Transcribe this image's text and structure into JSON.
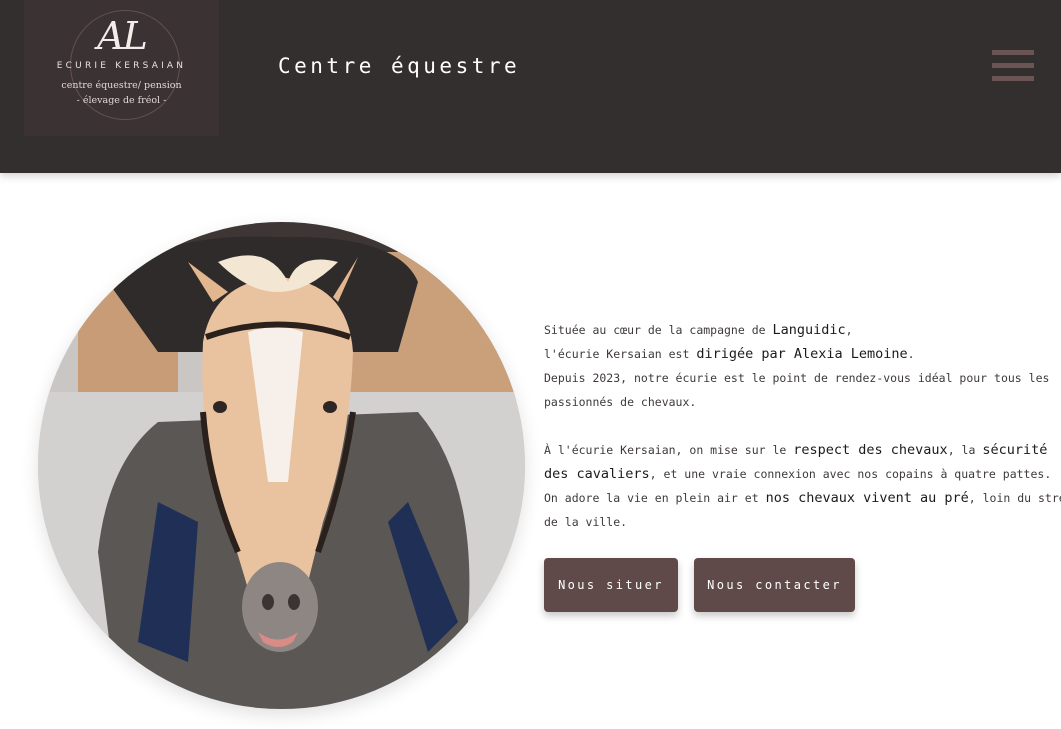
{
  "header": {
    "logo": {
      "monogram": "AL",
      "name": "ECURIE KERSAIAN",
      "subtitle_line1": "centre équestre/ pension",
      "subtitle_line2": "- élevage de fréol -"
    },
    "title": "Centre équestre",
    "menu_icon": "hamburger-menu-icon"
  },
  "colors": {
    "header_bg": "#332f2e",
    "button_bg": "#5f4a49",
    "menu_icon": "#6b5454"
  },
  "main": {
    "image": "horse-photo",
    "intro": {
      "p1": {
        "l1_a": "Située au cœur de la campagne de ",
        "l1_b": "Languidic",
        "l1_c": ",",
        "l2_a": "l'écurie Kersaian est ",
        "l2_b": "dirigée par Alexia Lemoine",
        "l2_c": ".",
        "l3": "Depuis 2023, notre écurie est le point de rendez-vous idéal pour tous les",
        "l4": "passionnés de chevaux."
      },
      "p2": {
        "l1_a": "À l'écurie Kersaian, on mise sur le ",
        "l1_b": "respect des chevaux",
        "l1_c": ", la ",
        "l1_d": "sécurité",
        "l2_a": "des cavaliers",
        "l2_b": ", et une vraie connexion avec nos copains à quatre pattes.",
        "l3_a": "On adore la vie en plein air et ",
        "l3_b": "nos chevaux vivent au pré",
        "l3_c": ", loin du stress",
        "l4": "de la ville."
      }
    },
    "buttons": {
      "situer": "Nous situer",
      "contact": "Nous contacter"
    }
  }
}
